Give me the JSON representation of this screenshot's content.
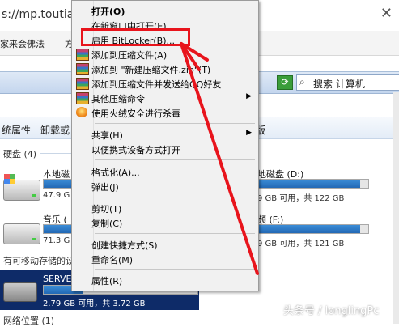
{
  "browser": {
    "url_text": "s://mp.toutiao",
    "close_glyph": "✕",
    "favorites": [
      "家来会佛法",
      "方"
    ]
  },
  "explorer": {
    "search_placeholder": "搜索 计算机",
    "toolbar": [
      "统属性",
      "卸载或",
      "版"
    ],
    "hard_disk_group": "硬盘 (4)",
    "removable_group": "有可移动存储的设",
    "network_group": "网络位置 (1)",
    "drives": [
      {
        "name": "本地磁",
        "info": "47.9 G",
        "fill": 0.62
      },
      {
        "name": "地磁盘 (D:)",
        "info": "9 GB 可用，共 122 GB",
        "fill": 0.93
      },
      {
        "name": "音乐 (",
        "info": "71.3 G",
        "fill": 0.41
      },
      {
        "name": "频 (F:)",
        "info": "9 GB 可用，共 121 GB",
        "fill": 0.93
      },
      {
        "name": "SERVER",
        "info": "2.79 GB 可用，共 3.72 GB",
        "fill": 0.25
      }
    ]
  },
  "context_menu": {
    "items": [
      {
        "label": "打开(O)",
        "bold": true
      },
      {
        "label": "在新窗口中打开(E)"
      },
      {
        "label": "启用 BitLocker(B)..."
      },
      {
        "label": "添加到压缩文件(A)",
        "icon": "winrar-icon"
      },
      {
        "label": "添加到 \"新建压缩文件.zip\"(T)",
        "icon": "winrar-icon"
      },
      {
        "label": "添加到压缩文件并发送给QQ好友",
        "icon": "winrar-icon"
      },
      {
        "label": "其他压缩命令",
        "icon": "winrar-icon",
        "submenu": true
      },
      {
        "label": "使用火绒安全进行杀毒",
        "icon": "huorong-shield-icon"
      },
      {
        "label": "共享(H)",
        "submenu": true
      },
      {
        "label": "以便携式设备方式打开"
      },
      {
        "label": "格式化(A)..."
      },
      {
        "label": "弹出(J)"
      },
      {
        "label": "剪切(T)"
      },
      {
        "label": "复制(C)"
      },
      {
        "label": "创建快捷方式(S)"
      },
      {
        "label": "重命名(M)"
      },
      {
        "label": "属性(R)"
      }
    ],
    "submenu_arrow": "▶"
  },
  "annotation": {
    "color": "#e8141c"
  },
  "watermark": "头条号 / longlingPc"
}
